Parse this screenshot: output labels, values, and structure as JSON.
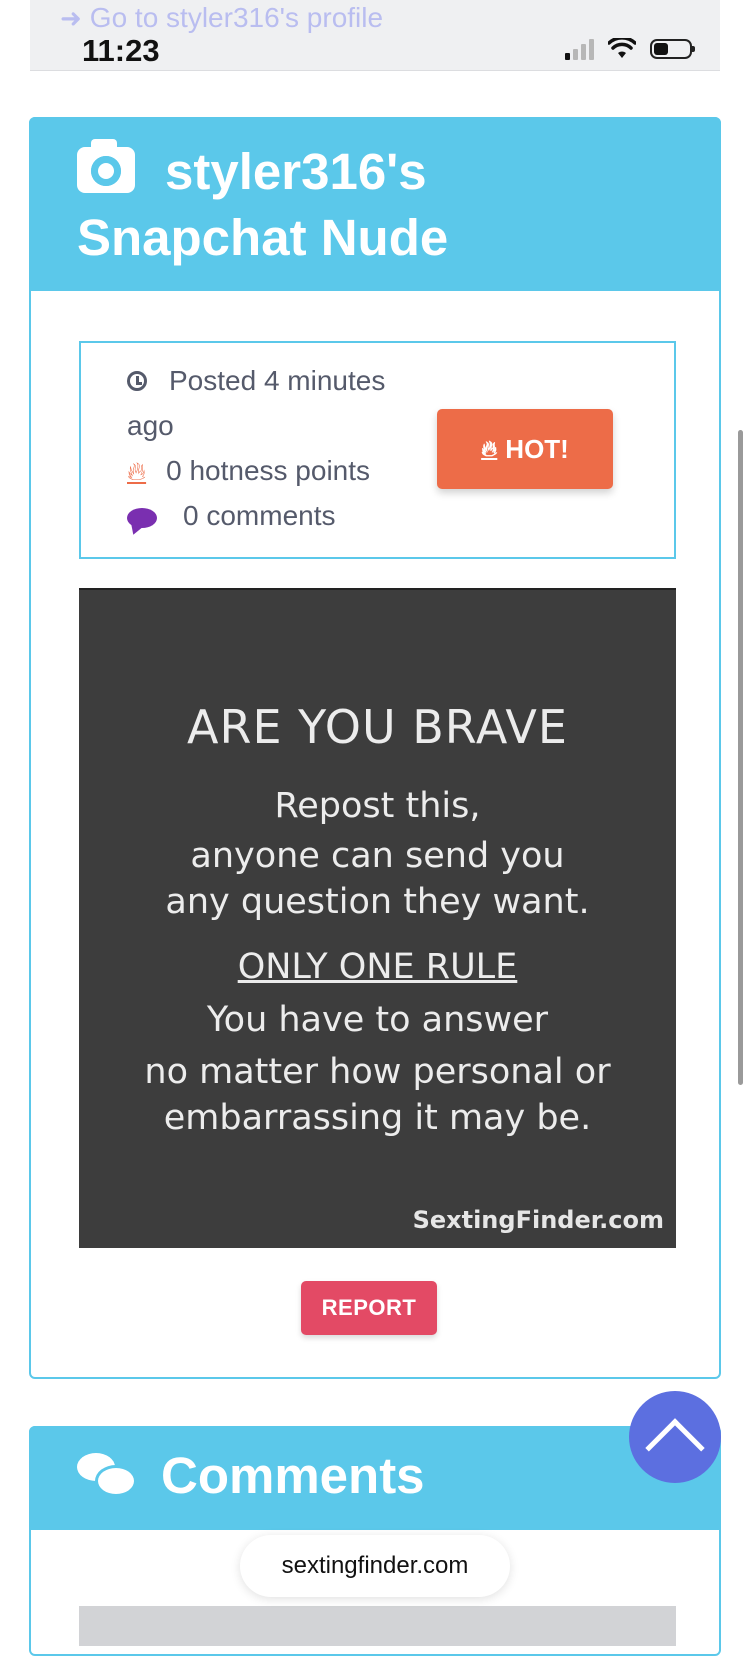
{
  "status_bar": {
    "time": "11:23",
    "profile_link": "Go to styler316's profile"
  },
  "post": {
    "title_line1": "styler316's",
    "title_line2": "Snapchat Nude",
    "posted_line1": "Posted 4 minutes",
    "posted_line2": "ago",
    "hotness": "0 hotness points",
    "comments_count": "0 comments",
    "hot_button": "HOT!",
    "report_button": "REPORT",
    "image": {
      "heading": "ARE YOU BRAVE",
      "line1": "Repost this,",
      "line2": "anyone can send you",
      "line3": "any question they want.",
      "rule": "ONLY ONE RULE",
      "line4": "You have to answer",
      "line5": "no matter how personal or",
      "line6": "embarrassing it may be.",
      "watermark": "SextingFinder.com"
    }
  },
  "comments": {
    "title": "Comments"
  },
  "browser": {
    "url": "sextingfinder.com"
  },
  "colors": {
    "header_bg": "#5bc8ea",
    "hot": "#ed6c48",
    "report": "#e34a65",
    "scroll_top": "#5c6fe0"
  },
  "icons": [
    "arrow-right-icon",
    "camera-icon",
    "clock-icon",
    "flame-icon",
    "comment-icon",
    "comments-icon",
    "chevron-up-icon"
  ]
}
